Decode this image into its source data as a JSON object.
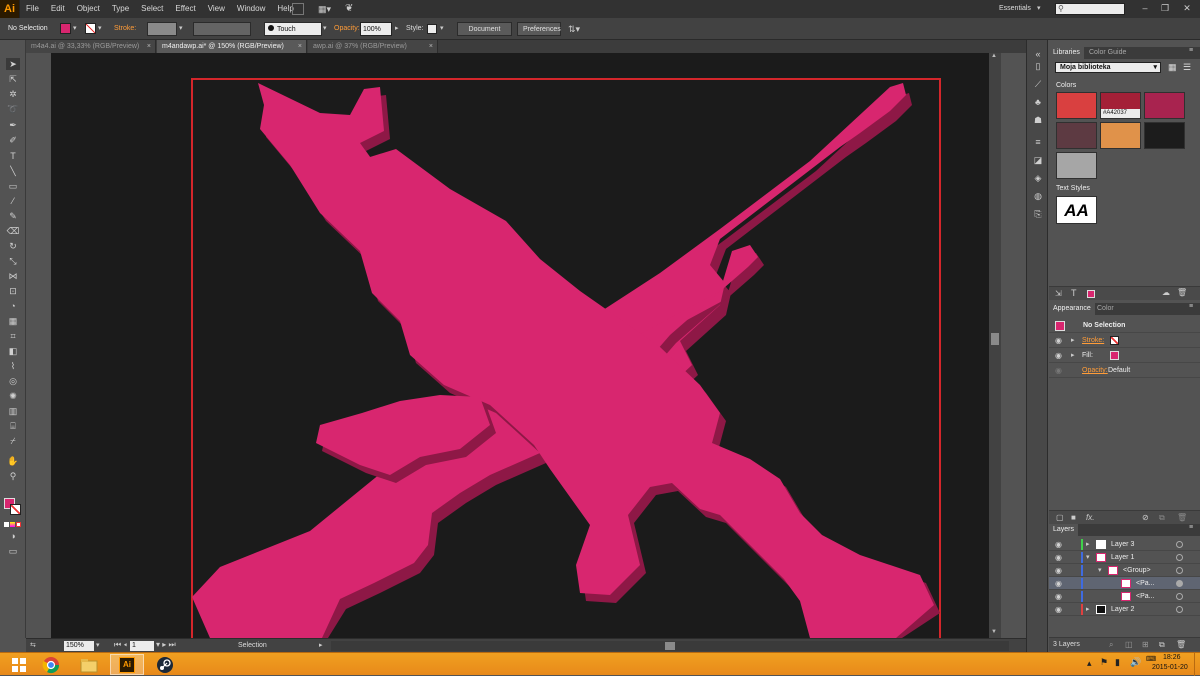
{
  "app": {
    "logo": "Ai"
  },
  "menu": [
    "File",
    "Edit",
    "Object",
    "Type",
    "Select",
    "Effect",
    "View",
    "Window",
    "Help"
  ],
  "workspace": {
    "label": "Essentials",
    "search_icon": "search-icon"
  },
  "control_bar": {
    "selection_label": "No Selection",
    "stroke_label": "Stroke:",
    "brush_label": "Touch Callig...",
    "opacity_label": "Opacity:",
    "opacity_value": "100%",
    "style_label": "Style:",
    "document_setup": "Document Setup",
    "preferences": "Preferences",
    "fill_color": "#d8266f"
  },
  "tabs": [
    {
      "label": "m4a4.ai @ 33,33% (RGB/Preview)",
      "close": "×"
    },
    {
      "label": "m4andawp.ai* @ 150% (RGB/Preview)",
      "close": "×"
    },
    {
      "label": "awp.ai @ 37% (RGB/Preview)",
      "close": "×"
    }
  ],
  "status_bar": {
    "zoom": "150%",
    "artboard": "1",
    "tool": "Selection"
  },
  "libraries": {
    "tabs": [
      "Libraries",
      "Color Guide"
    ],
    "library_name": "Moja biblioteka",
    "colors_heading": "Colors",
    "swatch_label": "#A42037",
    "swatches": [
      "#d94040",
      "#a42037",
      "#a8234f",
      "#5d3a42",
      "#e0924a",
      "#1c1c1c",
      "#a6a6a6"
    ],
    "text_styles_heading": "Text Styles",
    "text_style_sample": "AA"
  },
  "appearance": {
    "tabs": [
      "Appearance",
      "Color"
    ],
    "title": "No Selection",
    "stroke_label": "Stroke:",
    "fill_label": "Fill:",
    "opacity_label": "Opacity:",
    "opacity_value": "Default"
  },
  "layers": {
    "tab": "Layers",
    "rows": [
      {
        "name": "Layer 3",
        "color": "#3fd14a"
      },
      {
        "name": "Layer 1",
        "color": "#3f6be0"
      },
      {
        "name": "<Group>",
        "color": "#3f6be0"
      },
      {
        "name": "<Pa...",
        "color": "#3f6be0"
      },
      {
        "name": "<Pa...",
        "color": "#3f6be0"
      },
      {
        "name": "Layer 2",
        "color": "#e04040"
      }
    ],
    "count": "3 Layers"
  },
  "taskbar": {
    "time": "18:26",
    "date": "2015-01-20"
  },
  "colors": {
    "artwork": "#d8266f",
    "artwork_shadow": "#8e1846",
    "artboard_border": "#d4262b"
  }
}
